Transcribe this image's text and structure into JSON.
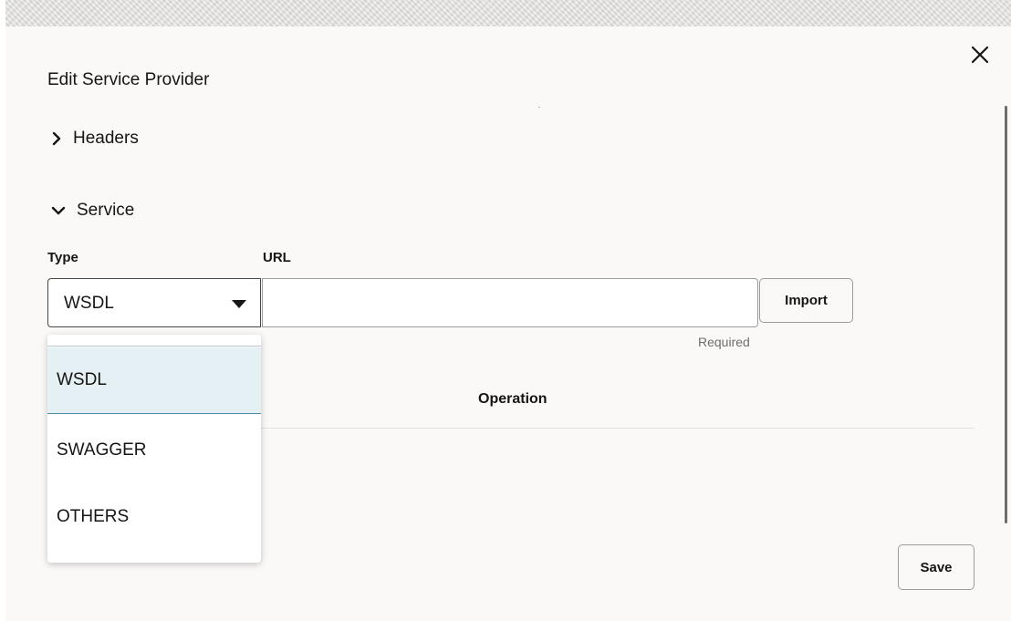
{
  "dialog": {
    "title": "Edit Service Provider",
    "close_icon": "close-icon"
  },
  "sections": {
    "headers": {
      "label": "Headers",
      "icon": "chevron-right-icon",
      "expanded": false
    },
    "service": {
      "label": "Service",
      "icon": "chevron-down-icon",
      "expanded": true
    }
  },
  "service": {
    "type_label": "Type",
    "url_label": "URL",
    "type_value": "WSDL",
    "url_value": "",
    "url_required_text": "Required",
    "import_label": "Import",
    "type_options": [
      {
        "label": "WSDL",
        "selected": true
      },
      {
        "label": "SWAGGER",
        "selected": false
      },
      {
        "label": "OTHERS",
        "selected": false
      }
    ]
  },
  "table": {
    "operation_header": "Operation"
  },
  "footer": {
    "save_label": "Save"
  },
  "colors": {
    "dialog_background": "#fbf9f8",
    "selected_option_background": "#e5f0f4",
    "selected_option_border": "#4f8aa6",
    "text": "#161513"
  }
}
